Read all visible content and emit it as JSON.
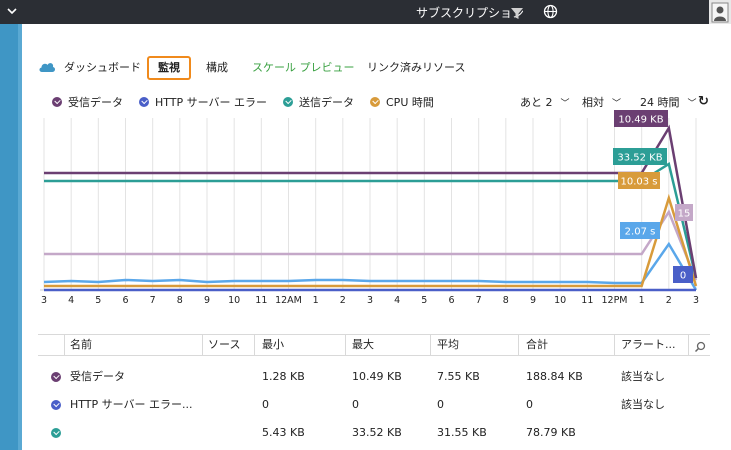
{
  "topbar": {
    "subscriptions_label": "サブスクリプション",
    "filter_icon": "filter-icon",
    "globe_icon": "globe-icon",
    "user_icon": "user-avatar-icon"
  },
  "nav": {
    "items": [
      {
        "label": "ダッシュボード"
      },
      {
        "label": "監視"
      },
      {
        "label": "構成"
      },
      {
        "label": "スケール プレビュー"
      },
      {
        "label": "リンク済みリソース"
      }
    ],
    "active_index": 1
  },
  "colors": {
    "received": "#6b3f72",
    "http_errors": "#4a5fc8",
    "sent": "#2c9e96",
    "cpu": "#d89b3b",
    "light_purple": "#c4a8c8",
    "light_blue": "#5aa7ea"
  },
  "legend": [
    {
      "label": "受信データ",
      "color": "#6b3f72"
    },
    {
      "label": "HTTP サーバー エラー",
      "color": "#4a5fc8"
    },
    {
      "label": "送信データ",
      "color": "#2c9e96"
    },
    {
      "label": "CPU 時間",
      "color": "#d89b3b"
    }
  ],
  "controls": {
    "more_label": "あと 2",
    "relative_label": "相対",
    "range_label": "24 時間",
    "refresh_icon": "refresh-icon"
  },
  "chart_data": {
    "type": "line",
    "x_tick_labels": [
      "3",
      "4",
      "5",
      "6",
      "7",
      "8",
      "9",
      "10",
      "11",
      "12AM",
      "1",
      "2",
      "3",
      "4",
      "5",
      "6",
      "7",
      "8",
      "9",
      "10",
      "11",
      "12PM",
      "1",
      "2",
      "3"
    ],
    "callouts": [
      {
        "label": "10.49 KB",
        "color": "#6b3f72"
      },
      {
        "label": "33.52 KB",
        "color": "#2c9e96"
      },
      {
        "label": "10.03 s",
        "color": "#d89b3b"
      },
      {
        "label": "15",
        "color": "#c4a8c8"
      },
      {
        "label": "2.07 s",
        "color": "#5aa7ea"
      },
      {
        "label": "0",
        "color": "#4a5fc8"
      }
    ],
    "series": [
      {
        "name": "受信データ",
        "color": "#6b3f72",
        "values": [
          7.55,
          7.55,
          7.55,
          7.55,
          7.55,
          7.55,
          7.55,
          7.55,
          7.55,
          7.55,
          7.55,
          7.55,
          7.55,
          7.55,
          7.55,
          7.55,
          7.55,
          7.55,
          7.55,
          7.55,
          7.55,
          7.55,
          7.55,
          10.49,
          0
        ]
      },
      {
        "name": "送信データ",
        "color": "#2c9e96",
        "values": [
          31.55,
          31.55,
          31.55,
          31.55,
          31.55,
          31.55,
          31.55,
          31.55,
          31.55,
          31.55,
          31.55,
          31.55,
          31.55,
          31.55,
          31.55,
          31.55,
          31.55,
          31.55,
          31.55,
          31.55,
          31.55,
          31.55,
          31.55,
          33.52,
          0
        ]
      },
      {
        "name": "CPU 時間",
        "color": "#d89b3b",
        "values": [
          0,
          0,
          0,
          0,
          0,
          0,
          0,
          0,
          0,
          0,
          0,
          0,
          0,
          0,
          0,
          0,
          0,
          0,
          0,
          0,
          0,
          0,
          0,
          10.03,
          0
        ]
      },
      {
        "name": "HTTP サーバー エラー",
        "color": "#4a5fc8",
        "values": [
          0,
          0,
          0,
          0,
          0,
          0,
          0,
          0,
          0,
          0,
          0,
          0,
          0,
          0,
          0,
          0,
          0,
          0,
          0,
          0,
          0,
          0,
          0,
          0,
          0
        ]
      }
    ]
  },
  "table": {
    "headers": [
      "名前",
      "ソース",
      "最小",
      "最大",
      "平均",
      "合計",
      "アラート..."
    ],
    "rows": [
      {
        "name": "受信データ",
        "source": "",
        "min": "1.28 KB",
        "max": "10.49 KB",
        "avg": "7.55 KB",
        "total": "188.84 KB",
        "alert": "該当なし",
        "color": "#6b3f72"
      },
      {
        "name": "HTTP サーバー エラー...",
        "source": "",
        "min": "0",
        "max": "0",
        "avg": "0",
        "total": "0",
        "alert": "該当なし",
        "color": "#4a5fc8"
      },
      {
        "name": "",
        "source": "",
        "min": "5.43 KB",
        "max": "33.52 KB",
        "avg": "31.55 KB",
        "total": "78.79 KB",
        "alert": "",
        "color": "#2c9e96"
      }
    ]
  }
}
